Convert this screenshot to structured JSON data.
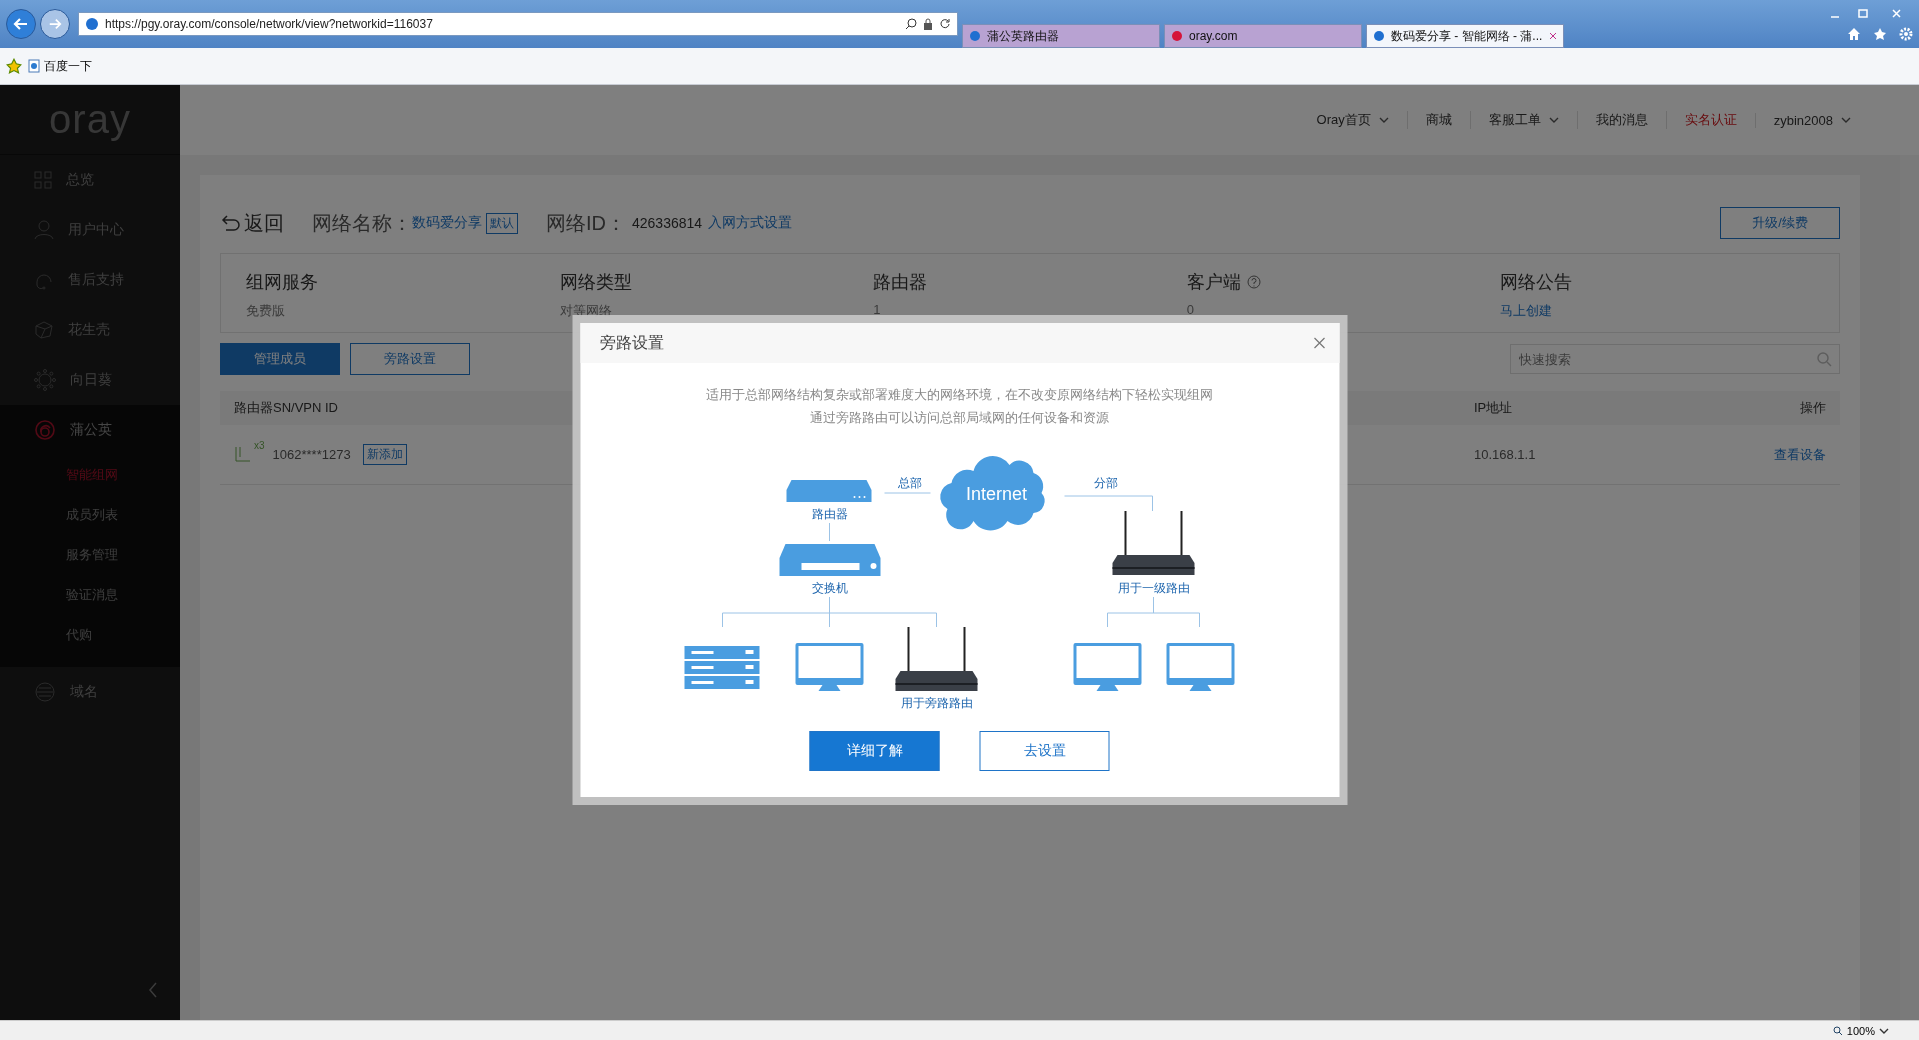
{
  "browser": {
    "address": "https://pgy.oray.com/console/network/view?networkid=116037",
    "tabs": [
      {
        "title": "蒲公英路由器",
        "selected": false
      },
      {
        "title": "oray.com",
        "selected": false
      },
      {
        "title": "数码爱分享 - 智能网络 - 蒲...",
        "selected": true
      }
    ],
    "favorites": [
      "百度一下"
    ],
    "zoom": "100%"
  },
  "sidebar": {
    "logo": "oray",
    "items": [
      {
        "label": "总览",
        "expanded": false
      },
      {
        "label": "用户中心",
        "expanded": false
      },
      {
        "label": "售后支持",
        "expanded": false
      },
      {
        "label": "花生壳",
        "expanded": false
      },
      {
        "label": "向日葵",
        "expanded": false
      },
      {
        "label": "蒲公英",
        "expanded": true,
        "children": [
          {
            "label": "智能组网",
            "selected": true
          },
          {
            "label": "成员列表",
            "selected": false
          },
          {
            "label": "服务管理",
            "selected": false
          },
          {
            "label": "验证消息",
            "selected": false
          },
          {
            "label": "代购",
            "selected": false
          }
        ]
      },
      {
        "label": "域名",
        "expanded": false
      }
    ]
  },
  "top_nav": [
    {
      "label": "Oray首页",
      "dropdown": true,
      "highlight": false
    },
    {
      "label": "商城",
      "dropdown": false,
      "highlight": false
    },
    {
      "label": "客服工单",
      "dropdown": true,
      "highlight": false
    },
    {
      "label": "我的消息",
      "dropdown": false,
      "highlight": false
    },
    {
      "label": "实名认证",
      "dropdown": false,
      "highlight": true
    },
    {
      "label": "zybin2008",
      "dropdown": true,
      "highlight": false
    }
  ],
  "network": {
    "back": "返回",
    "name_label": "网络名称：",
    "name": "数码爱分享",
    "name_badge": "默认",
    "id_label": "网络ID：",
    "id": "426336814",
    "join_link": "入网方式设置",
    "upgrade": "升级/续费"
  },
  "stats": [
    {
      "title": "组网服务",
      "value": "免费版",
      "kind": "text",
      "help": false
    },
    {
      "title": "网络类型",
      "value": "对等网络",
      "kind": "text",
      "help": false
    },
    {
      "title": "路由器",
      "value": "1",
      "kind": "text",
      "help": false
    },
    {
      "title": "客户端",
      "value": "0",
      "kind": "text",
      "help": true
    },
    {
      "title": "网络公告",
      "value": "马上创建",
      "kind": "link",
      "help": false
    }
  ],
  "tabs": [
    {
      "label": "管理成员",
      "selected": true
    },
    {
      "label": "旁路设置",
      "selected": false
    }
  ],
  "search": {
    "placeholder": "快速搜索"
  },
  "table": {
    "columns": [
      "路由器SN/VPN ID",
      "IP地址",
      "操作"
    ],
    "rows": [
      {
        "count": "x3",
        "sn": "1062****1273",
        "badge": "新添加",
        "ip": "10.168.1.1",
        "action": "查看设备"
      }
    ]
  },
  "modal": {
    "title": "旁路设置",
    "description": [
      "适用于总部网络结构复杂或部署难度大的网络环境，在不改变原网络结构下轻松实现组网",
      "通过旁路路由可以访问总部局域网的任何设备和资源"
    ],
    "diagram": {
      "headquarters": "总部",
      "branch": "分部",
      "cloud": "Internet",
      "router": "路由器",
      "switch": "交换机",
      "branch_router": "用于一级路由",
      "bypass_router": "用于旁路路由"
    },
    "buttons": [
      {
        "label": "详细了解",
        "kind": "primary"
      },
      {
        "label": "去设置",
        "kind": "secondary"
      }
    ]
  }
}
